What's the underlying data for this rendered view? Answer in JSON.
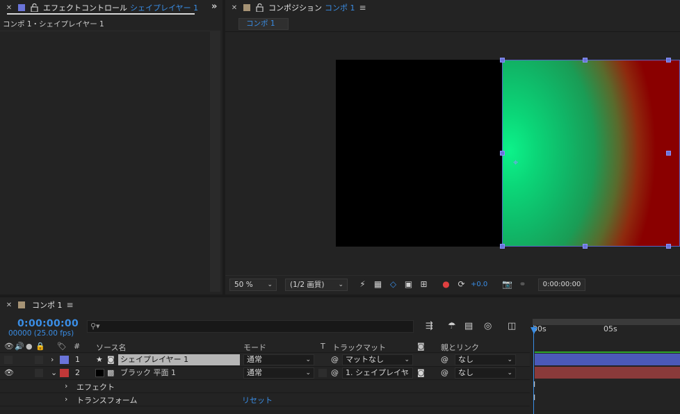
{
  "effect_panel": {
    "title": "エフェクトコントロール",
    "subject": "シェイプレイヤー 1",
    "breadcrumb": "コンポ 1・シェイプレイヤー 1",
    "swatch_color": "#6a74d9",
    "overflow": "»"
  },
  "composition_panel": {
    "title": "コンポジション",
    "subject": "コンポ 1",
    "chip_label": "コンポ 1",
    "swatch_color": "#a69375",
    "menu": "≡",
    "toolbar": {
      "zoom": "50 %",
      "resolution": "(1/2 画質)",
      "exposure": "+0.0",
      "timecode": "0:00:00:00"
    }
  },
  "timeline": {
    "tab_label": "コンポ 1",
    "menu": "≡",
    "swatch_color": "#a69375",
    "timecode": "0:00:00:00",
    "frames": "00000 (25.00 fps)",
    "search_placeholder": "⚲▾",
    "ruler": {
      "start": "00s",
      "mid": "05s"
    },
    "columns": {
      "num": "#",
      "source": "ソース名",
      "mode": "モード",
      "t": "T",
      "matte": "トラックマット",
      "parent": "親とリンク"
    },
    "layers": [
      {
        "num": "1",
        "name": "シェイプレイヤー 1",
        "mode": "通常",
        "matte": "マットなし",
        "parent": "なし",
        "color": "#6a74d9",
        "star": "★"
      },
      {
        "num": "2",
        "name": "ブラック 平面 1",
        "mode": "通常",
        "matte": "1. シェイプレイヤ",
        "parent": "なし",
        "color": "#c03838"
      }
    ],
    "sub_rows": [
      {
        "label": "エフェクト"
      },
      {
        "label": "トランスフォーム",
        "action": "リセット"
      }
    ]
  }
}
